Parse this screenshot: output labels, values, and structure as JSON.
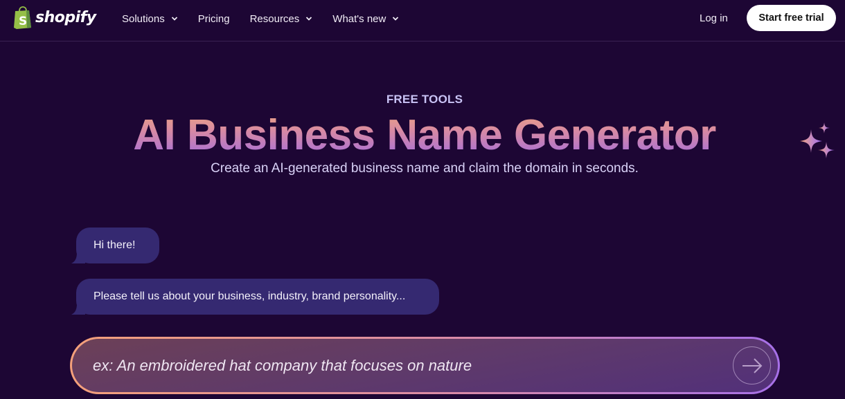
{
  "nav": {
    "logo_text": "shopify",
    "items": [
      {
        "label": "Solutions",
        "has_dropdown": true
      },
      {
        "label": "Pricing",
        "has_dropdown": false
      },
      {
        "label": "Resources",
        "has_dropdown": true
      },
      {
        "label": "What's new",
        "has_dropdown": true
      }
    ],
    "login_label": "Log in",
    "cta_label": "Start free trial"
  },
  "hero": {
    "eyebrow": "FREE TOOLS",
    "title": "AI Business Name Generator",
    "subtitle": "Create an AI-generated business name and claim the domain in seconds.",
    "icon": "sparkles-icon"
  },
  "chat": {
    "messages": [
      {
        "text": "Hi there!"
      },
      {
        "text": "Please tell us about your business, industry, brand personality..."
      }
    ],
    "input": {
      "value": "",
      "placeholder": "ex: An embroidered hat company that focuses on nature"
    },
    "send_icon": "arrow-right-icon"
  },
  "colors": {
    "background": "#1d0634",
    "logo_green": "#95bf47",
    "bubble": "#352971",
    "gradient_start": "#eda57f",
    "gradient_end": "#a06be0"
  }
}
